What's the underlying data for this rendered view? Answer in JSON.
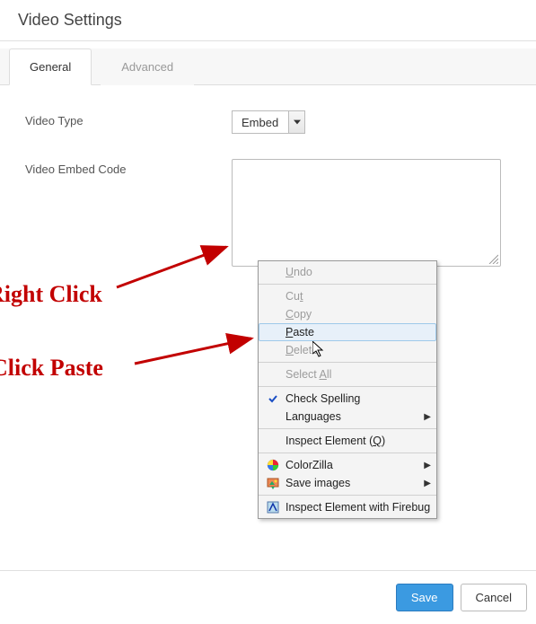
{
  "dialog": {
    "title": "Video Settings"
  },
  "tabs": {
    "general": "General",
    "advanced": "Advanced",
    "active": "general"
  },
  "fields": {
    "video_type_label": "Video Type",
    "video_type_value": "Embed",
    "embed_code_label": "Video Embed Code",
    "embed_code_value": ""
  },
  "context_menu": {
    "undo": "Undo",
    "cut": "Cut",
    "copy": "Copy",
    "paste": "Paste",
    "delete": "Delete",
    "select_all": "Select All",
    "check_spelling": "Check Spelling",
    "languages": "Languages",
    "inspect_element_pre": "Inspect Element (",
    "inspect_element_key": "Q",
    "inspect_element_post": ")",
    "colorzilla": "ColorZilla",
    "save_images": "Save images",
    "inspect_firebug": "Inspect Element with Firebug"
  },
  "annotations": {
    "right_click": "Right Click",
    "click_paste": "Click Paste"
  },
  "footer": {
    "save": "Save",
    "cancel": "Cancel"
  },
  "icons": {
    "dropdown": "chevron-down-icon",
    "check": "check-icon",
    "arrow_right": "submenu-arrow-icon",
    "colorzilla": "colorzilla-icon",
    "save_images": "save-images-icon",
    "firebug": "firebug-icon",
    "cursor": "cursor-icon"
  },
  "colors": {
    "annotation": "#c20000",
    "primary_button": "#3b9ae1",
    "hover_bg": "#e7f0f9"
  }
}
